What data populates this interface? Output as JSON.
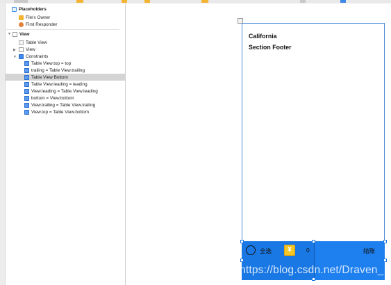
{
  "outline": {
    "placeholders": "Placeholders",
    "files_owner": "File's Owner",
    "first_responder": "First Responder",
    "view": "View",
    "table_view": "Table View",
    "subview": "View",
    "constraints": "Constraints",
    "items": [
      "Table View.top = top",
      "trailing = Table View.trailing",
      "Table View Bottom",
      "Table View.leading = leading",
      "View.leading = Table View.leading",
      "bottom = View.bottom",
      "View.trailing = Table View.trailing",
      "View.top = Table View.bottom"
    ],
    "selected_item": "Table View Bottom"
  },
  "scene": {
    "cell_title": "California",
    "section_footer": "Section Footer",
    "select_all": "全选",
    "yen_symbol": "¥",
    "count": "0",
    "checkout": "结账"
  },
  "watermark": "https://blog.csdn.net/Draven_",
  "colors": {
    "accent_blue": "#1a78e4",
    "selection_gray": "#d4d4d4"
  }
}
